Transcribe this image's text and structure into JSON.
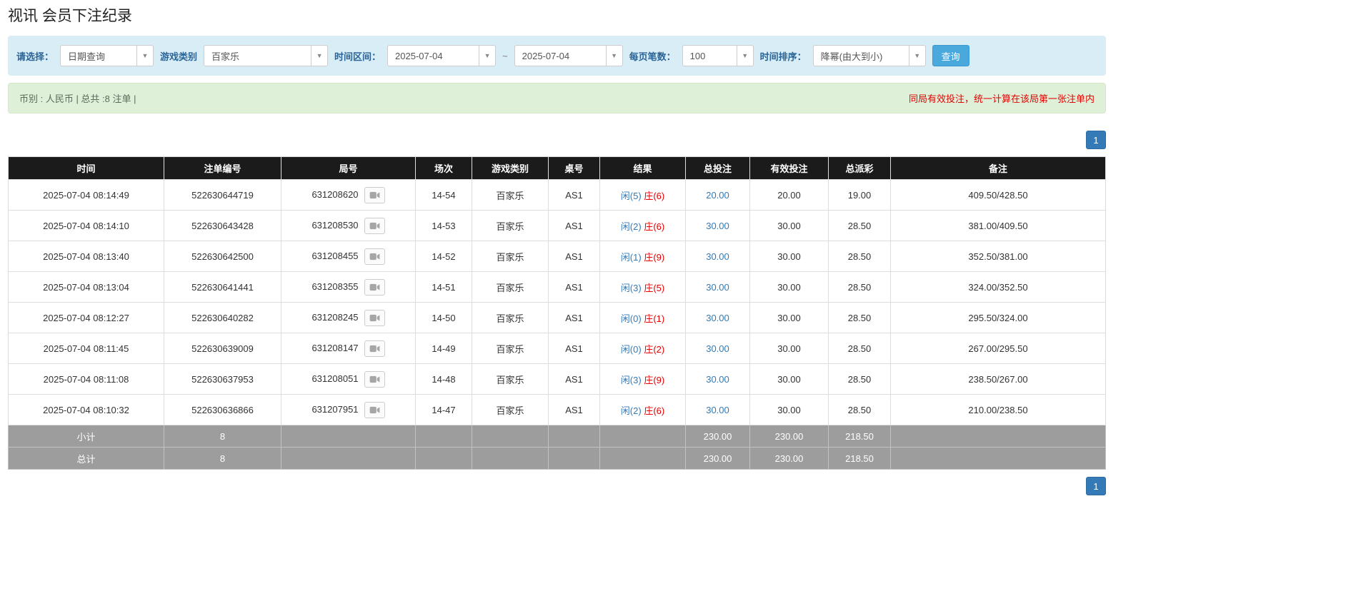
{
  "page": {
    "title": "视讯 会员下注纪录"
  },
  "filters": {
    "select_label": "请选择：",
    "select_value": "日期查询",
    "game_type_label": "游戏类别",
    "game_type_value": "百家乐",
    "time_range_label": "时间区间：",
    "date_from": "2025-07-04",
    "tilde": "~",
    "date_to": "2025-07-04",
    "page_size_label": "每页笔数：",
    "page_size_value": "100",
    "sort_label": "时间排序：",
    "sort_value": "降幂(由大到小)",
    "query_button": "查询"
  },
  "summary": {
    "left": "币别 : 人民币 | 总共 :8 注单 |",
    "right": "同局有效投注，统一计算在该局第一张注单内"
  },
  "pagination": {
    "page": "1"
  },
  "table": {
    "headers": [
      "时间",
      "注单编号",
      "局号",
      "场次",
      "游戏类别",
      "桌号",
      "结果",
      "总投注",
      "有效投注",
      "总派彩",
      "备注"
    ],
    "rows": [
      {
        "time": "2025-07-04 08:14:49",
        "bet_id": "522630644719",
        "round_id": "631208620",
        "session": "14-54",
        "game": "百家乐",
        "table_no": "AS1",
        "player": "闲(5)",
        "banker": "庄(6)",
        "total_bet": "20.00",
        "valid_bet": "20.00",
        "payout": "19.00",
        "remark": "409.50/428.50"
      },
      {
        "time": "2025-07-04 08:14:10",
        "bet_id": "522630643428",
        "round_id": "631208530",
        "session": "14-53",
        "game": "百家乐",
        "table_no": "AS1",
        "player": "闲(2)",
        "banker": "庄(6)",
        "total_bet": "30.00",
        "valid_bet": "30.00",
        "payout": "28.50",
        "remark": "381.00/409.50"
      },
      {
        "time": "2025-07-04 08:13:40",
        "bet_id": "522630642500",
        "round_id": "631208455",
        "session": "14-52",
        "game": "百家乐",
        "table_no": "AS1",
        "player": "闲(1)",
        "banker": "庄(9)",
        "total_bet": "30.00",
        "valid_bet": "30.00",
        "payout": "28.50",
        "remark": "352.50/381.00"
      },
      {
        "time": "2025-07-04 08:13:04",
        "bet_id": "522630641441",
        "round_id": "631208355",
        "session": "14-51",
        "game": "百家乐",
        "table_no": "AS1",
        "player": "闲(3)",
        "banker": "庄(5)",
        "total_bet": "30.00",
        "valid_bet": "30.00",
        "payout": "28.50",
        "remark": "324.00/352.50"
      },
      {
        "time": "2025-07-04 08:12:27",
        "bet_id": "522630640282",
        "round_id": "631208245",
        "session": "14-50",
        "game": "百家乐",
        "table_no": "AS1",
        "player": "闲(0)",
        "banker": "庄(1)",
        "total_bet": "30.00",
        "valid_bet": "30.00",
        "payout": "28.50",
        "remark": "295.50/324.00"
      },
      {
        "time": "2025-07-04 08:11:45",
        "bet_id": "522630639009",
        "round_id": "631208147",
        "session": "14-49",
        "game": "百家乐",
        "table_no": "AS1",
        "player": "闲(0)",
        "banker": "庄(2)",
        "total_bet": "30.00",
        "valid_bet": "30.00",
        "payout": "28.50",
        "remark": "267.00/295.50"
      },
      {
        "time": "2025-07-04 08:11:08",
        "bet_id": "522630637953",
        "round_id": "631208051",
        "session": "14-48",
        "game": "百家乐",
        "table_no": "AS1",
        "player": "闲(3)",
        "banker": "庄(9)",
        "total_bet": "30.00",
        "valid_bet": "30.00",
        "payout": "28.50",
        "remark": "238.50/267.00"
      },
      {
        "time": "2025-07-04 08:10:32",
        "bet_id": "522630636866",
        "round_id": "631207951",
        "session": "14-47",
        "game": "百家乐",
        "table_no": "AS1",
        "player": "闲(2)",
        "banker": "庄(6)",
        "total_bet": "30.00",
        "valid_bet": "30.00",
        "payout": "28.50",
        "remark": "210.00/238.50"
      }
    ],
    "footer": [
      {
        "label": "小计",
        "count": "8",
        "total_bet": "230.00",
        "valid_bet": "230.00",
        "payout": "218.50"
      },
      {
        "label": "总计",
        "count": "8",
        "total_bet": "230.00",
        "valid_bet": "230.00",
        "payout": "218.50"
      }
    ]
  }
}
